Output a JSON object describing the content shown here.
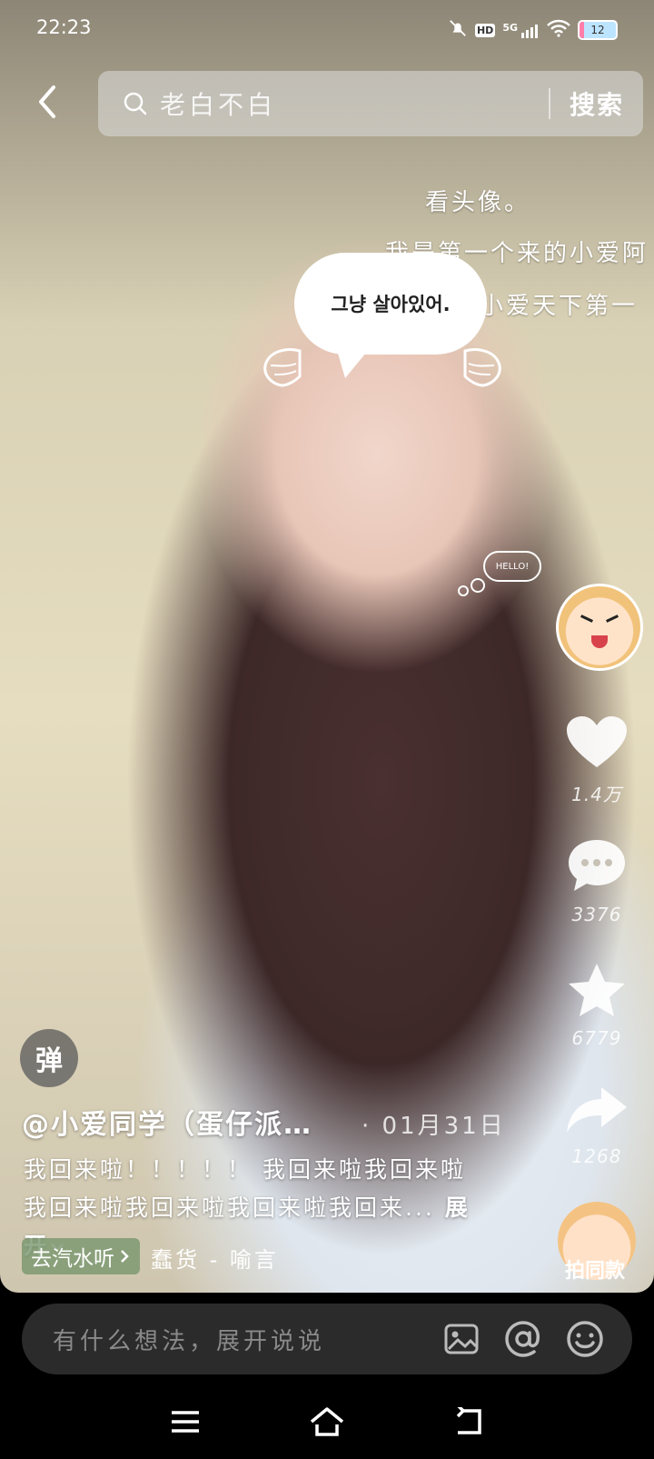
{
  "status_bar": {
    "time": "22:23",
    "network": "5G",
    "hd": "HD",
    "battery": "12"
  },
  "search": {
    "query": "老白不白",
    "button": "搜索"
  },
  "video_overlay": {
    "line1": "看头像。",
    "line2": "我是第一个来的小爱阿",
    "line3": "小爱天下第一",
    "bubble_text": "그냥 살아있어.",
    "hello": "HELLO!"
  },
  "actions": {
    "likes": "1.4万",
    "comments": "3376",
    "favorites": "6779",
    "shares": "1268"
  },
  "post": {
    "danmaku": "弹",
    "author": "@小爱同学（蛋仔派…",
    "date": "· 01月31日",
    "description": "我回来啦！！！！！ 我回来啦我回来啦我回来啦我回来啦我回来啦我回来...",
    "expand": "展开",
    "music_button": "去汽水听",
    "song": "蠢货 - 喻言",
    "same_style": "拍同款"
  },
  "comment_bar": {
    "placeholder": "有什么想法，展开说说"
  },
  "colors": {
    "accent_music": "#7a9670",
    "comment_bg": "#2b2b2b"
  }
}
